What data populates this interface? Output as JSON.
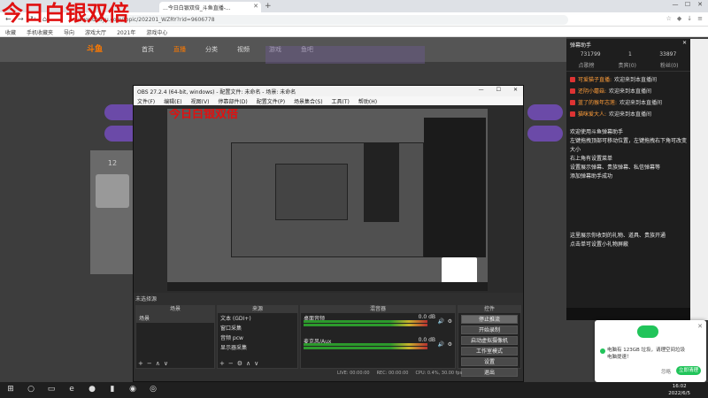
{
  "overlay_title": "今日白银双倍",
  "browser": {
    "tab_title": "...今日白银双倍_斗鱼直播-...",
    "url": "www.douyu.com/topic/202201_WZRY?rid=9606778",
    "bookmarks": [
      "收藏",
      "手机收藏夹",
      "导向",
      "游戏大厅",
      "2021年",
      "游戏中心"
    ]
  },
  "site": {
    "logo": "斗鱼",
    "nav_items": [
      "首页",
      "直播",
      "分类",
      "视频",
      "游戏",
      "鱼吧"
    ],
    "left_num": "12"
  },
  "danmu": {
    "title": "弹幕助手",
    "stats": [
      "731799",
      "1",
      "33897"
    ],
    "tabs": [
      "点歌榜",
      "贵宾(0)",
      "粉丝(0)"
    ],
    "messages": [
      {
        "user": "可爱猫子直播:",
        "text": "欢迎来到本直播间"
      },
      {
        "user": "还阴小蘑菇:",
        "text": "欢迎来到本直播间"
      },
      {
        "user": "蓝了的猴年志莲:",
        "text": "欢迎来到本直播间"
      },
      {
        "user": "猫咪爱大人:",
        "text": "欢迎来到本直播间"
      }
    ],
    "help": "欢迎使用斗鱼弹幕助手\n左键拖拽顶部可移动位置，左键拖拽右下角可改变大小\n右上角有设置菜单\n设置展示弹幕、贵族弹幕、私信弹幕等\n添加弹幕助手成功",
    "help2": "这里展示你收到的礼物、道具、贵族开通\n点击单可设置小礼物屏蔽"
  },
  "obs": {
    "title": "OBS 27.2.4 (64-bit, windows) - 配置文件: 未命名 - 场景: 未命名",
    "menu": [
      "文件(F)",
      "编辑(E)",
      "视图(V)",
      "停靠部件(D)",
      "配置文件(P)",
      "场景集合(S)",
      "工具(T)",
      "帮助(H)"
    ],
    "preview_overlay": "今日白银双倍",
    "no_source": "未选择源",
    "scenes_title": "场景",
    "scenes": [
      "场景"
    ],
    "sources_title": "来源",
    "sources": [
      "文本 (GDI+)",
      "窗口采集",
      "音频 pcw",
      "显示器采集"
    ],
    "mixer_title": "混音器",
    "mixer": [
      {
        "name": "桌面音频",
        "db": "0.0 dB"
      },
      {
        "name": "麦克风/Aux",
        "db": "0.0 dB"
      }
    ],
    "controls_title": "控件",
    "controls": [
      "停止推流",
      "开始录制",
      "启动虚拟摄像机",
      "工作室模式",
      "设置",
      "退出"
    ],
    "status": [
      "LIVE: 00:00:00",
      "REC: 00:00:00",
      "CPU: 0.4%, 30.00 fps"
    ]
  },
  "notify": {
    "text": "电脑有 123GB 垃圾，请理空间垃圾电脑提速！",
    "ignore": "忽略",
    "button": "立即清理"
  },
  "taskbar": {
    "clock_time": "16:02",
    "clock_date": "2022/6/5"
  }
}
